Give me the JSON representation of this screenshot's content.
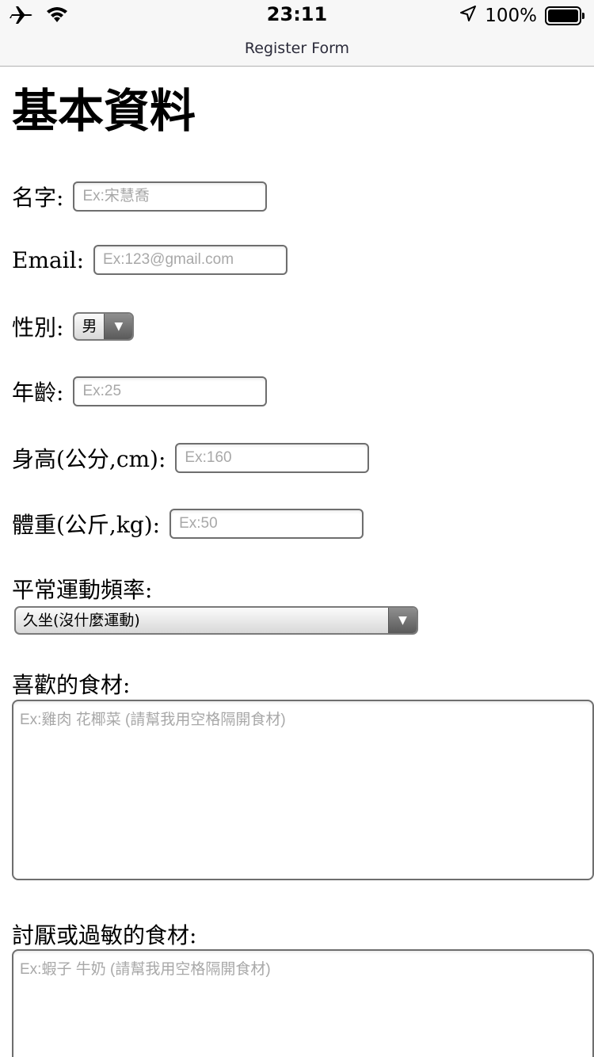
{
  "status_bar": {
    "time": "23:11",
    "battery_text": "100%",
    "icons": [
      "airplane-icon",
      "wifi-icon",
      "location-arrow-icon",
      "battery-icon"
    ]
  },
  "nav": {
    "title": "Register Form"
  },
  "form": {
    "title": "基本資料",
    "name": {
      "label": "名字:",
      "placeholder": "Ex:宋慧喬"
    },
    "email": {
      "label": "Email:",
      "placeholder": "Ex:123@gmail.com"
    },
    "gender": {
      "label": "性別:",
      "value": "男"
    },
    "age": {
      "label": "年齡:",
      "placeholder": "Ex:25"
    },
    "height": {
      "label": "身高(公分,cm):",
      "placeholder": "Ex:160"
    },
    "weight": {
      "label": "體重(公斤,kg):",
      "placeholder": "Ex:50"
    },
    "exercise": {
      "label": "平常運動頻率:",
      "value": "久坐(沒什麼運動)"
    },
    "liked_ingredients": {
      "label": "喜歡的食材:",
      "placeholder": "Ex:雞肉 花椰菜 (請幫我用空格隔開食材)"
    },
    "disliked_ingredients": {
      "label": "討厭或過敏的食材:",
      "placeholder": "Ex:蝦子 牛奶 (請幫我用空格隔開食材)"
    }
  }
}
